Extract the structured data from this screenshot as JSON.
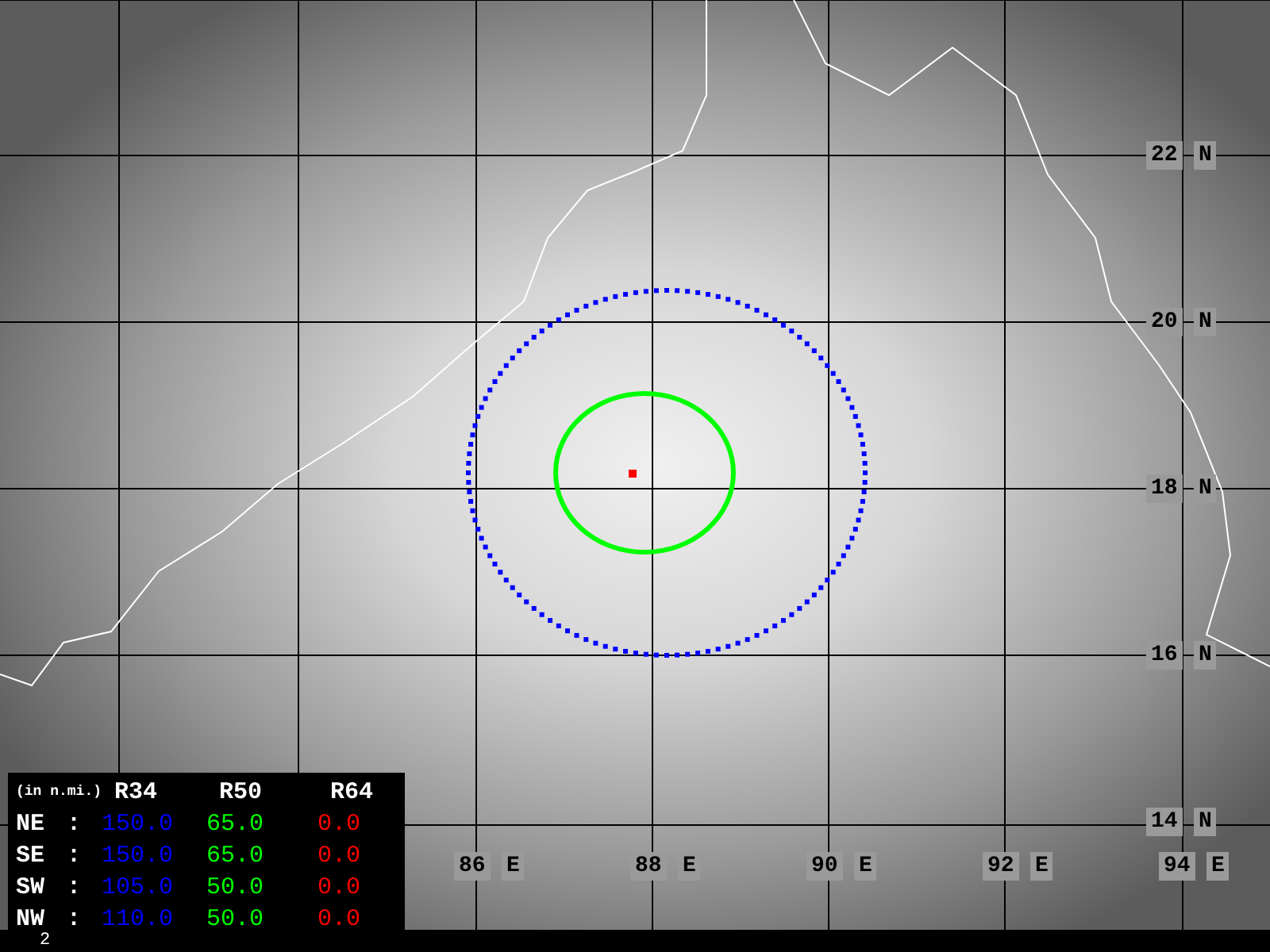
{
  "map": {
    "latitude_labels": [
      {
        "value": "22",
        "hemisphere": "N"
      },
      {
        "value": "20",
        "hemisphere": "N"
      },
      {
        "value": "18",
        "hemisphere": "N"
      },
      {
        "value": "16",
        "hemisphere": "N"
      },
      {
        "value": "14",
        "hemisphere": "N"
      }
    ],
    "longitude_labels": [
      {
        "value": "86",
        "hemisphere": "E"
      },
      {
        "value": "88",
        "hemisphere": "E"
      },
      {
        "value": "90",
        "hemisphere": "E"
      },
      {
        "value": "92",
        "hemisphere": "E"
      },
      {
        "value": "94",
        "hemisphere": "E"
      }
    ]
  },
  "legend": {
    "unit_note": "(in n.mi.)",
    "columns": [
      {
        "label": "R34",
        "color": "#0000ff"
      },
      {
        "label": "R50",
        "color": "#00ff00"
      },
      {
        "label": "R64",
        "color": "#ff0000"
      }
    ],
    "rows": [
      {
        "quadrant": "NE",
        "separator": ":",
        "values": [
          "150.0",
          "65.0",
          "0.0"
        ]
      },
      {
        "quadrant": "SE",
        "separator": ":",
        "values": [
          "150.0",
          "65.0",
          "0.0"
        ]
      },
      {
        "quadrant": "SW",
        "separator": ":",
        "values": [
          "105.0",
          "50.0",
          "0.0"
        ]
      },
      {
        "quadrant": "NW",
        "separator": ":",
        "values": [
          "110.0",
          "50.0",
          "0.0"
        ]
      }
    ]
  },
  "footer": {
    "frame_number": "2"
  }
}
